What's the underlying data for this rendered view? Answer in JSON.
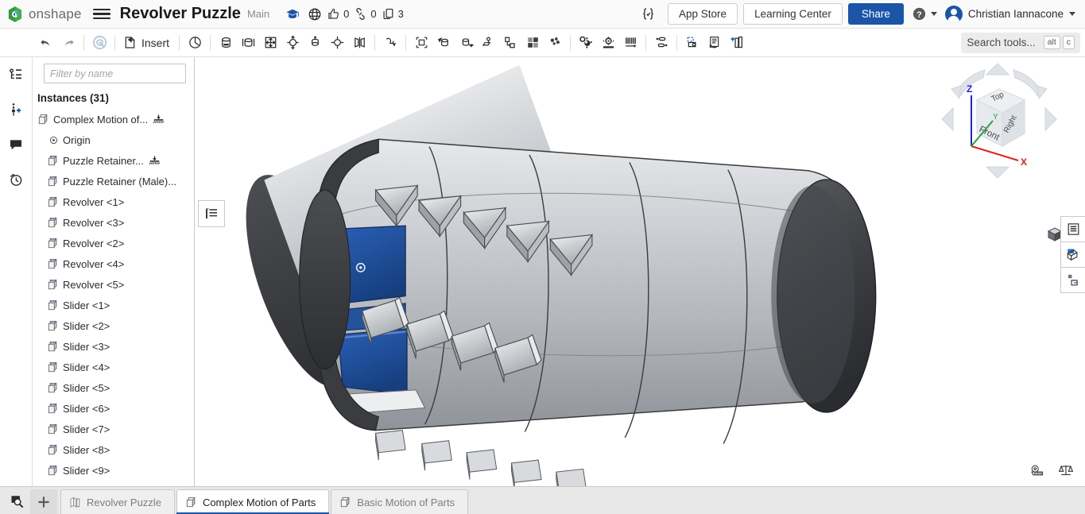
{
  "header": {
    "logo_text": "onshape",
    "logo_icon": "onshape-logo-icon",
    "menu_icon": "hamburger-menu-icon",
    "doc_title": "Revolver Puzzle",
    "branch": "Main",
    "learn_icon": "graduation-cap-icon",
    "public_icon": "globe-icon",
    "like_icon": "thumbs-up-icon",
    "like_count": "0",
    "link_icon": "link-icon",
    "link_count": "0",
    "copies_icon": "copy-icon",
    "copies_count": "3",
    "featurescript_icon": "featurescript-braces-icon",
    "app_store_label": "App Store",
    "learning_center_label": "Learning Center",
    "share_label": "Share",
    "help_icon": "help-question-icon",
    "avatar_name": "avatar",
    "user_name": "Christian Iannacone"
  },
  "toolbar": {
    "undo_icon": "undo-arrow-icon",
    "redo_icon": "redo-arrow-icon",
    "regenerate_icon": "regenerate-circle-icon",
    "insert_icon": "insert-part-icon",
    "insert_label": "Insert",
    "tools": [
      {
        "name": "fastened-mate-icon"
      },
      {
        "name": "revolute-mate-icon"
      },
      {
        "name": "slider-mate-icon"
      },
      {
        "name": "planar-mate-icon"
      },
      {
        "name": "cylindrical-mate-icon"
      },
      {
        "name": "pin-slot-mate-icon"
      },
      {
        "name": "ball-mate-icon"
      },
      {
        "name": "parallel-mate-icon"
      },
      {
        "name": "tangent-mate-icon"
      },
      {
        "name": "mate-connector-icon"
      },
      {
        "name": "group-icon"
      },
      {
        "name": "replicate-icon"
      },
      {
        "name": "boolean-assembly-icon"
      },
      {
        "name": "transform-instance-icon"
      },
      {
        "name": "pattern-instance-icon"
      },
      {
        "name": "assembly-feature-icon"
      },
      {
        "name": "gear-relation-icon"
      },
      {
        "name": "rack-pinion-relation-icon"
      },
      {
        "name": "screw-relation-icon"
      },
      {
        "name": "linear-relation-icon"
      },
      {
        "name": "exploded-view-icon"
      },
      {
        "name": "display-state-icon"
      },
      {
        "name": "bill-of-materials-icon"
      }
    ],
    "search_placeholder": "Search tools...",
    "search_key_alt": "alt",
    "search_key_letter": "c"
  },
  "leftrail": {
    "items": [
      {
        "name": "feature-tree-icon"
      },
      {
        "name": "add-version-icon"
      },
      {
        "name": "comments-icon"
      },
      {
        "name": "history-icon"
      }
    ]
  },
  "panel": {
    "filter_icon": "funnel-filter-icon",
    "filter_placeholder": "Filter by name",
    "list_options_icon": "list-options-icon",
    "instances_header": "Instances (31)",
    "nodes": [
      {
        "label": "Complex Motion of...",
        "icon": "assembly-icon",
        "indent": 0,
        "suffix": "fixed-ground-icon"
      },
      {
        "label": "Origin",
        "icon": "origin-icon",
        "indent": 1,
        "suffix": ""
      },
      {
        "label": "Puzzle Retainer...",
        "icon": "part-instance-icon",
        "indent": 2,
        "suffix": "fixed-ground-icon"
      },
      {
        "label": "Puzzle Retainer (Male)...",
        "icon": "part-instance-icon",
        "indent": 2,
        "suffix": ""
      },
      {
        "label": "Revolver <1>",
        "icon": "part-instance-icon",
        "indent": 2,
        "suffix": ""
      },
      {
        "label": "Revolver <3>",
        "icon": "part-instance-icon",
        "indent": 2,
        "suffix": ""
      },
      {
        "label": "Revolver <2>",
        "icon": "part-instance-icon",
        "indent": 2,
        "suffix": ""
      },
      {
        "label": "Revolver <4>",
        "icon": "part-instance-icon",
        "indent": 2,
        "suffix": ""
      },
      {
        "label": "Revolver <5>",
        "icon": "part-instance-icon",
        "indent": 2,
        "suffix": ""
      },
      {
        "label": "Slider <1>",
        "icon": "part-instance-icon",
        "indent": 2,
        "suffix": ""
      },
      {
        "label": "Slider <2>",
        "icon": "part-instance-icon",
        "indent": 2,
        "suffix": ""
      },
      {
        "label": "Slider <3>",
        "icon": "part-instance-icon",
        "indent": 2,
        "suffix": ""
      },
      {
        "label": "Slider <4>",
        "icon": "part-instance-icon",
        "indent": 2,
        "suffix": ""
      },
      {
        "label": "Slider <5>",
        "icon": "part-instance-icon",
        "indent": 2,
        "suffix": ""
      },
      {
        "label": "Slider <6>",
        "icon": "part-instance-icon",
        "indent": 2,
        "suffix": ""
      },
      {
        "label": "Slider <7>",
        "icon": "part-instance-icon",
        "indent": 2,
        "suffix": ""
      },
      {
        "label": "Slider <8>",
        "icon": "part-instance-icon",
        "indent": 2,
        "suffix": ""
      },
      {
        "label": "Slider <9>",
        "icon": "part-instance-icon",
        "indent": 2,
        "suffix": ""
      }
    ]
  },
  "viewport": {
    "tree_toggle_icon": "instance-list-toggle-icon",
    "viewcube": {
      "top_label": "Top",
      "front_label": "Front",
      "right_label": "Right",
      "axis_x": "X",
      "axis_y": "Y",
      "axis_z": "Z",
      "color_x": "#e02020",
      "color_y": "#23a23a",
      "color_z": "#2020d8"
    },
    "view_mode_icon": "shaded-cube-icon",
    "right_panel_buttons": [
      {
        "name": "assembly-list-panel-icon"
      },
      {
        "name": "appearance-panel-icon"
      },
      {
        "name": "instance-properties-panel-icon"
      }
    ],
    "status_icons": [
      {
        "name": "measure-tape-icon"
      },
      {
        "name": "mass-properties-scale-icon"
      }
    ],
    "model": {
      "name": "revolver-puzzle-cylinder",
      "body_color": "#b9bcc0",
      "endcap_color": "#3e3f42",
      "selected_color": "#1f4b99",
      "edge_color": "#2a2a2a"
    }
  },
  "tabbar": {
    "search_icon": "search-tabs-icon",
    "add_icon": "add-tab-icon",
    "tabs": [
      {
        "label": "Revolver Puzzle",
        "icon": "part-studio-icon",
        "active": false
      },
      {
        "label": "Complex Motion of Parts",
        "icon": "assembly-tab-icon",
        "active": true
      },
      {
        "label": "Basic Motion of Parts",
        "icon": "assembly-tab-icon",
        "active": false
      }
    ]
  }
}
